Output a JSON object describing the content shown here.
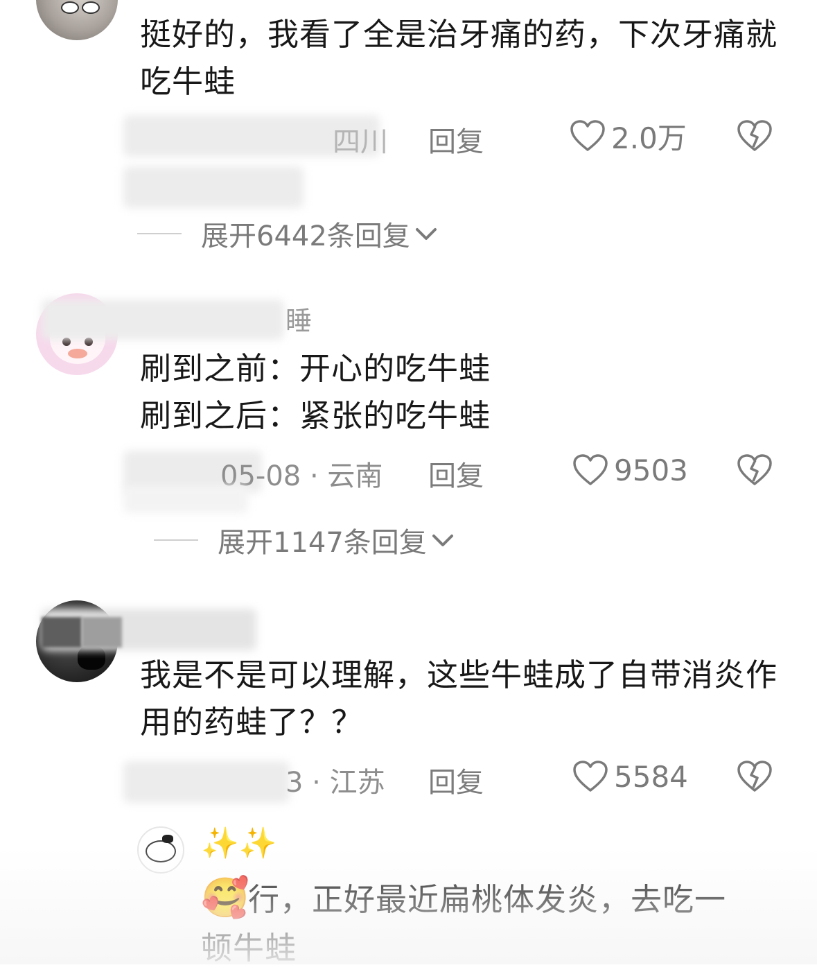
{
  "comments": [
    {
      "username": "",
      "text": "挺好的，我看了全是治牙痛的药，下次牙痛就吃牛蛙",
      "meta": "四川",
      "reply_label": "回复",
      "likes": "2.0万",
      "expand_label": "展开6442条回复"
    },
    {
      "username": "睡",
      "text_line1": "刷到之前：开心的吃牛蛙",
      "text_line2": "刷到之后：紧张的吃牛蛙",
      "meta": "05-08 · 云南",
      "reply_label": "回复",
      "likes": "9503",
      "expand_label": "展开1147条回复"
    },
    {
      "username": "",
      "text": "我是不是可以理解，这些牛蛙成了自带消炎作用的药蛙了？？",
      "meta": "3 · 江苏",
      "reply_label": "回复",
      "likes": "5584"
    }
  ],
  "reply": {
    "username": "✨✨",
    "emoji": "🥰",
    "text_line1": "行，正好最近扁桃体发炎，去吃一",
    "text_line2": "顿牛蛙"
  },
  "colors": {
    "text": "#181818",
    "meta": "#8d8d8d",
    "icon": "#7a7a7a"
  }
}
